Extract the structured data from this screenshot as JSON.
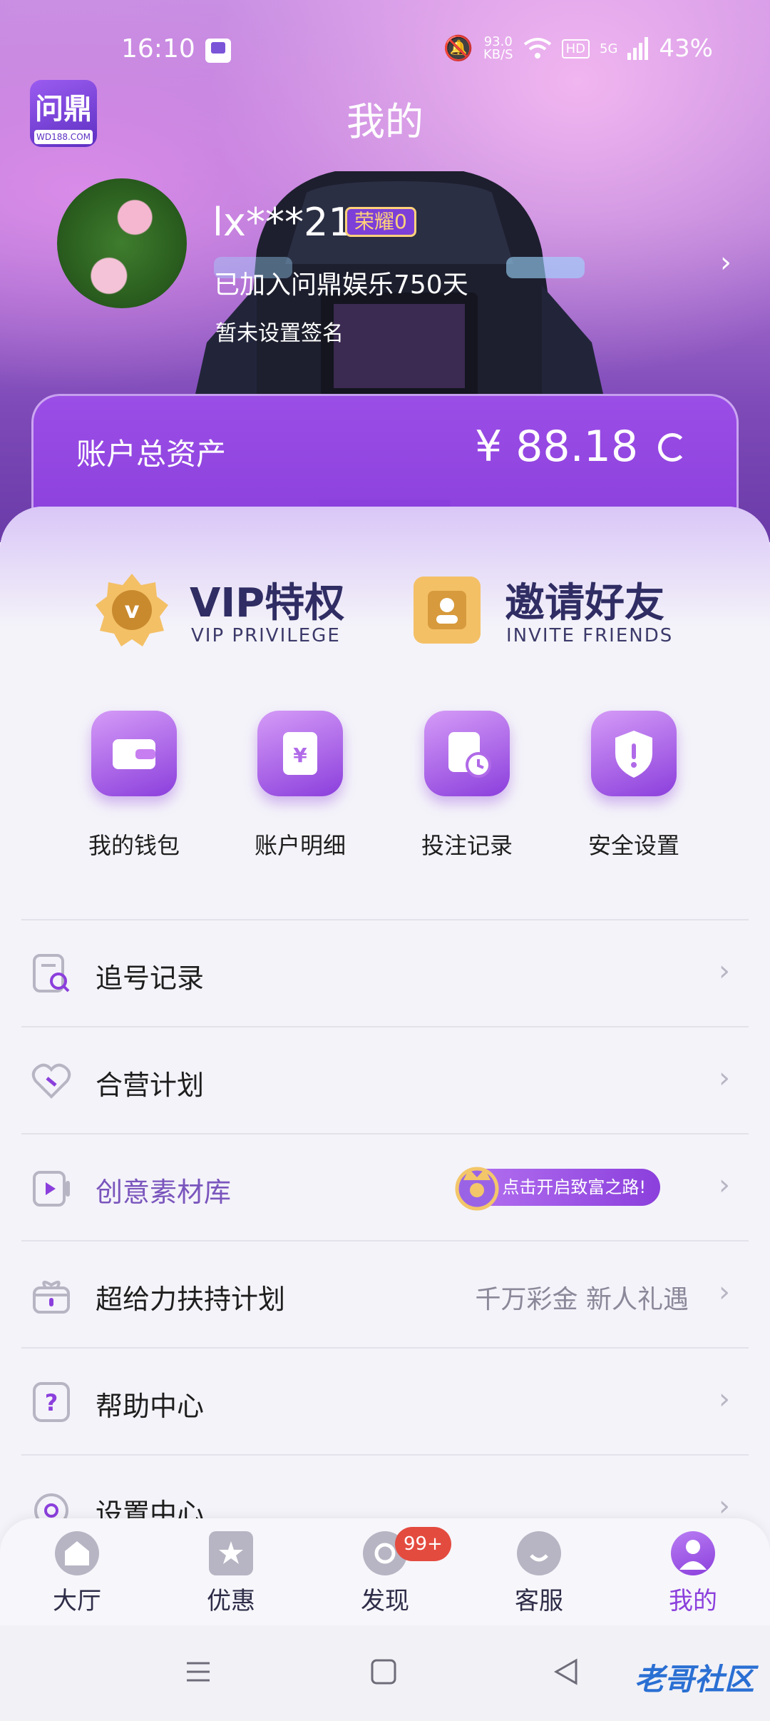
{
  "status_bar": {
    "time": "16:10",
    "speed": "93.0",
    "speed_unit": "KB/S",
    "hd": "HD",
    "network": "5G",
    "battery": "43%"
  },
  "header": {
    "title": "我的",
    "logo_text": "问鼎",
    "logo_sub": "WD188.COM"
  },
  "profile": {
    "username": "lx***21",
    "rank": "荣耀0",
    "joined": "已加入问鼎娱乐750天",
    "signature": "暂未设置签名"
  },
  "assets": {
    "label": "账户总资产",
    "value": "¥ 88.18"
  },
  "promos": [
    {
      "title": "VIP特权",
      "subtitle": "VIP PRIVILEGE"
    },
    {
      "title": "邀请好友",
      "subtitle": "INVITE FRIENDS"
    }
  ],
  "quick_actions": [
    {
      "label": "我的钱包",
      "icon": "wallet-icon"
    },
    {
      "label": "账户明细",
      "icon": "account-detail-icon"
    },
    {
      "label": "投注记录",
      "icon": "bet-record-icon"
    },
    {
      "label": "安全设置",
      "icon": "security-shield-icon"
    }
  ],
  "menu": [
    {
      "label": "追号记录",
      "icon": "search-record-icon",
      "extra": ""
    },
    {
      "label": "合营计划",
      "icon": "partnership-heart-icon",
      "extra": ""
    },
    {
      "label": "创意素材库",
      "icon": "video-library-icon",
      "extra": "",
      "banner": "点击开启致富之路!"
    },
    {
      "label": "超给力扶持计划",
      "icon": "gift-icon",
      "extra": "千万彩金 新人礼遇"
    },
    {
      "label": "帮助中心",
      "icon": "help-icon",
      "extra": ""
    },
    {
      "label": "设置中心",
      "icon": "settings-icon",
      "extra": ""
    }
  ],
  "tabbar": [
    {
      "label": "大厅",
      "icon": "home-icon"
    },
    {
      "label": "优惠",
      "icon": "promo-star-icon"
    },
    {
      "label": "发现",
      "icon": "discover-icon",
      "badge": "99+"
    },
    {
      "label": "客服",
      "icon": "service-icon"
    },
    {
      "label": "我的",
      "icon": "profile-icon",
      "active": true
    }
  ],
  "watermark": "老哥社区",
  "colors": {
    "accent": "#8b3fdc",
    "badge": "#e44b3f",
    "text_dark": "#1e1e1e"
  }
}
